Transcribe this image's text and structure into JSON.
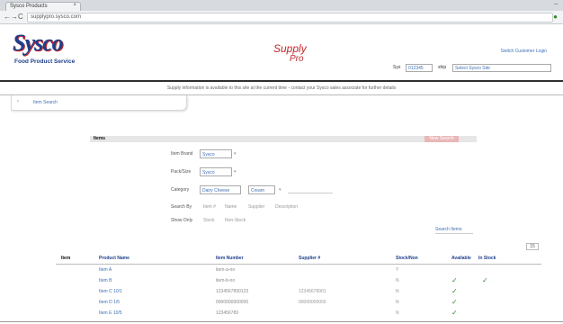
{
  "browser": {
    "tab_title": "Sysco Products",
    "tab_close": "×",
    "window_min": "–",
    "nav_back": "←",
    "nav_forward": "→",
    "nav_reload": "C",
    "url": "supplypro.sysco.com",
    "extension_icon": "●"
  },
  "header": {
    "logo_word": "Sysco",
    "logo_tagline": "Food Product Service",
    "supply_logo_main": "Supply",
    "supply_logo_pro": "Pro",
    "top_link": "Switch Customer Login",
    "filter": {
      "label1": "Sys",
      "value1": "012345",
      "label2": "ship",
      "value2": "Select Sysco Site"
    }
  },
  "banner": {
    "text": "Supply information is available to this site at the current time - contact your Sysco sales associate for further details"
  },
  "breadcrumb": {
    "arrow": "‹",
    "text": "Item Search"
  },
  "filter_panel": {
    "title": "Items",
    "button": "New Search",
    "rows": [
      {
        "label": "Item Brand",
        "select": "Sysco",
        "extra": "▾"
      },
      {
        "label": "Pack/Size",
        "select": "Sysco",
        "extra": "▾"
      },
      {
        "label": "Category",
        "select": "Dairy Cheese",
        "select2": "Cream",
        "extra": "▾"
      },
      {
        "label": "Search By",
        "opt1": "Item #",
        "opt2": "Name",
        "opt3": "Supplier",
        "opt4": "Description"
      },
      {
        "label": "Show Only",
        "opt1": "Stock",
        "opt2": "Non-Stock"
      }
    ],
    "search_button": "Search Items",
    "count": "15"
  },
  "table": {
    "headers": {
      "pos": "Item",
      "name": "Product Name",
      "id": "Item Number",
      "code": "Supplier #",
      "stock": "Stock/Non",
      "check1": "Available",
      "check2": "In Stock"
    },
    "rows": [
      {
        "name": "Item A",
        "id": "item-a-no",
        "code": "",
        "stock": "Y",
        "check1": "",
        "check2": ""
      },
      {
        "name": "Item B",
        "id": "item-b-no",
        "code": "",
        "stock": "N",
        "check1": "✓",
        "check2": "✓"
      },
      {
        "name": "Item C 10/1",
        "id": "1234567890123",
        "code": "12345678901",
        "stock": "N",
        "check1": "✓",
        "check2": ""
      },
      {
        "name": "Item D 1/5",
        "id": "0000000000000",
        "code": "00000000000",
        "stock": "N",
        "check1": "✓",
        "check2": ""
      },
      {
        "name": "Item E 10/5",
        "id": "123456789",
        "code": "",
        "stock": "N",
        "check1": "✓",
        "check2": ""
      }
    ]
  },
  "colors": {
    "brand_blue": "#1d3f8c",
    "brand_red": "#c1272d",
    "link_blue": "#3f6fb5",
    "check_green": "#2e8b2e"
  }
}
